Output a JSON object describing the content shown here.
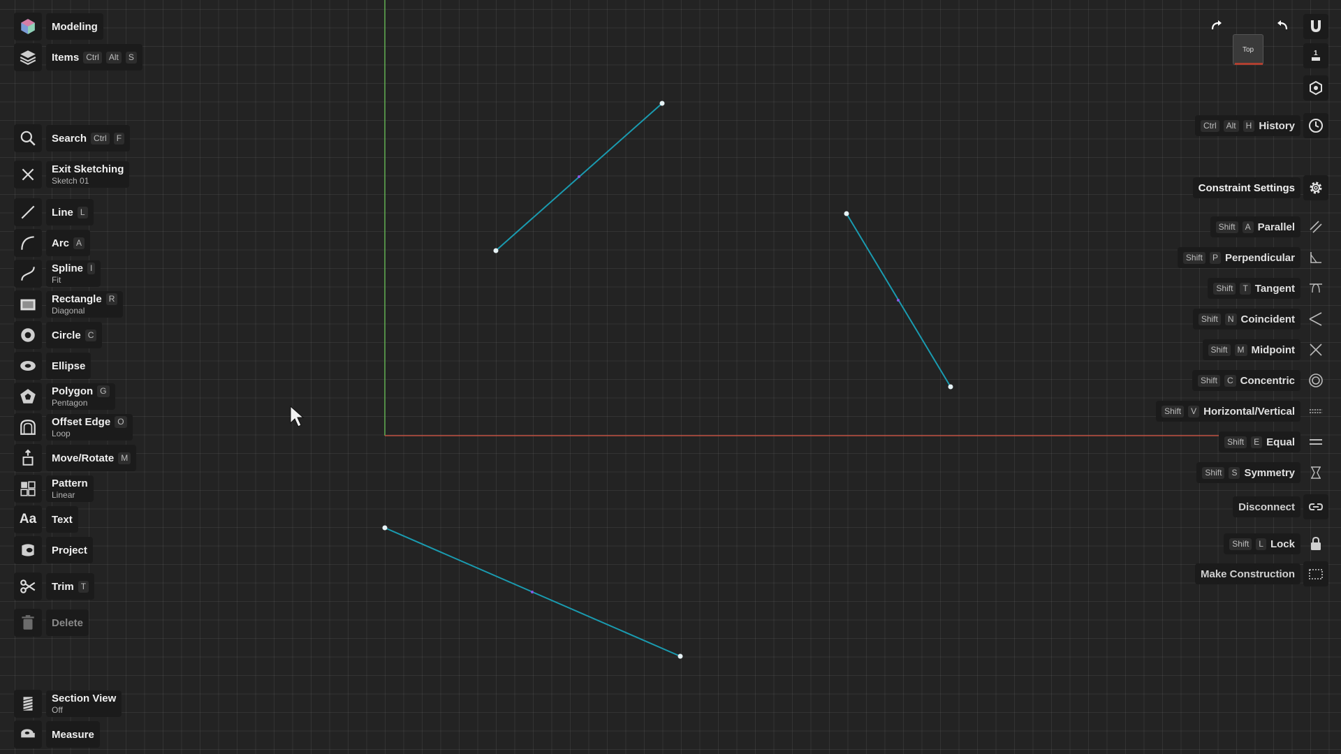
{
  "colors": {
    "background": "#232323",
    "x_axis": "#c0503f",
    "y_axis": "#5fae4f",
    "sketch_line": "#1a9bb0",
    "endpoint": "#e6f2f5",
    "midpoint": "#8a56e6"
  },
  "toolbar": {
    "modeling": {
      "label": "Modeling",
      "icon": "app-logo-icon"
    },
    "items": {
      "label": "Items",
      "keys": [
        "Ctrl",
        "Alt",
        "S"
      ],
      "icon": "layers-icon"
    },
    "search": {
      "label": "Search",
      "keys": [
        "Ctrl",
        "F"
      ],
      "icon": "search-icon"
    },
    "exit_sketching": {
      "label": "Exit Sketching",
      "sub": "Sketch 01",
      "icon": "close-icon"
    },
    "line": {
      "label": "Line",
      "key": "L",
      "icon": "line-icon"
    },
    "arc": {
      "label": "Arc",
      "key": "A",
      "icon": "arc-icon"
    },
    "spline": {
      "label": "Spline",
      "key": "I",
      "sub": "Fit",
      "icon": "spline-icon"
    },
    "rectangle": {
      "label": "Rectangle",
      "key": "R",
      "sub": "Diagonal",
      "icon": "rectangle-icon"
    },
    "circle": {
      "label": "Circle",
      "key": "C",
      "icon": "circle-icon"
    },
    "ellipse": {
      "label": "Ellipse",
      "icon": "ellipse-icon"
    },
    "polygon": {
      "label": "Polygon",
      "key": "G",
      "sub": "Pentagon",
      "icon": "polygon-icon"
    },
    "offset_edge": {
      "label": "Offset Edge",
      "key": "O",
      "sub": "Loop",
      "icon": "offset-edge-icon"
    },
    "move_rotate": {
      "label": "Move/Rotate",
      "key": "M",
      "icon": "move-rotate-icon"
    },
    "pattern": {
      "label": "Pattern",
      "sub": "Linear",
      "icon": "pattern-icon"
    },
    "text": {
      "label": "Text",
      "icon": "text-icon",
      "glyph": "Aa"
    },
    "project": {
      "label": "Project",
      "icon": "project-icon"
    },
    "trim": {
      "label": "Trim",
      "key": "T",
      "icon": "scissors-icon"
    },
    "delete": {
      "label": "Delete",
      "icon": "trash-icon"
    },
    "section_view": {
      "label": "Section View",
      "sub": "Off",
      "icon": "section-view-icon"
    },
    "measure": {
      "label": "Measure",
      "icon": "measure-icon"
    }
  },
  "view_cube": {
    "face": "Top"
  },
  "right_panel": {
    "top_icons": [
      "magnet-icon",
      "align-icon",
      "view-cube-icon"
    ],
    "history": {
      "label": "History",
      "keys": [
        "Ctrl",
        "Alt",
        "H"
      ],
      "icon": "clock-icon"
    },
    "constraint_settings": {
      "label": "Constraint Settings",
      "icon": "gear-icon"
    },
    "constraints": [
      {
        "label": "Parallel",
        "keys": [
          "Shift",
          "A"
        ],
        "icon": "parallel-icon"
      },
      {
        "label": "Perpendicular",
        "keys": [
          "Shift",
          "P"
        ],
        "icon": "perpendicular-icon"
      },
      {
        "label": "Tangent",
        "keys": [
          "Shift",
          "T"
        ],
        "icon": "tangent-icon"
      },
      {
        "label": "Coincident",
        "keys": [
          "Shift",
          "N"
        ],
        "icon": "coincident-icon"
      },
      {
        "label": "Midpoint",
        "keys": [
          "Shift",
          "M"
        ],
        "icon": "midpoint-icon"
      },
      {
        "label": "Concentric",
        "keys": [
          "Shift",
          "C"
        ],
        "icon": "concentric-icon"
      },
      {
        "label": "Horizontal/Vertical",
        "keys": [
          "Shift",
          "V"
        ],
        "icon": "horizontal-vertical-icon"
      },
      {
        "label": "Equal",
        "keys": [
          "Shift",
          "E"
        ],
        "icon": "equal-icon"
      },
      {
        "label": "Symmetry",
        "keys": [
          "Shift",
          "S"
        ],
        "icon": "symmetry-icon"
      }
    ],
    "disconnect": {
      "label": "Disconnect",
      "icon": "disconnect-icon"
    },
    "lock": {
      "label": "Lock",
      "keys": [
        "Shift",
        "L"
      ],
      "icon": "lock-icon"
    },
    "make_construction": {
      "label": "Make Construction",
      "icon": "construction-icon"
    }
  }
}
